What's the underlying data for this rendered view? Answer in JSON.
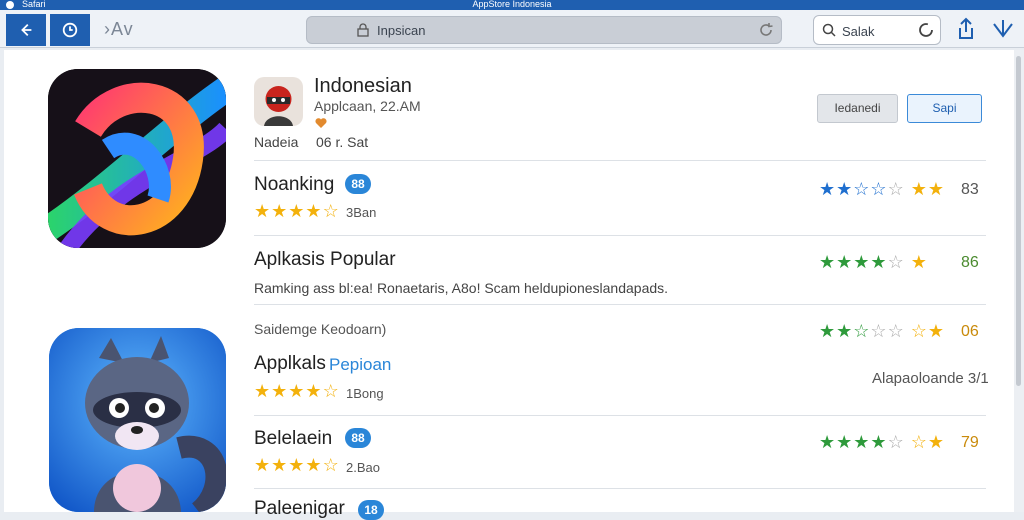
{
  "titlebar": {
    "app_name": "Safari",
    "window_title": "AppStore Indonesia"
  },
  "toolbar": {
    "breadcrumb": "›Av",
    "address": "Inpsican",
    "search_text": "Salak"
  },
  "header": {
    "title": "Indonesian",
    "subtitle": "Applcaan, 22.AM",
    "meta_left": "Nadeia",
    "meta_right": "06 r. Sat",
    "button_secondary": "Iedanedi",
    "button_primary": "Sapi"
  },
  "rows": [
    {
      "title": "Noanking",
      "badge": "88",
      "star_count": "3Ban",
      "rating_num": "83",
      "stars_filled": 2
    },
    {
      "title": "Aplkasis Popular",
      "description": "Ramking ass bl:ea! Ronaetaris, A8o! Scam heldupioneslandapads.",
      "rating_num": "86",
      "stars_filled": 4
    },
    {
      "overline": "Saidemge Keodoarn)",
      "rating_num": "06",
      "stars_filled": 2
    },
    {
      "title_part1": "Applkals",
      "title_part2": "Pepioan",
      "star_count": "1Bong",
      "right_note": "Alapaoloande 3/1"
    },
    {
      "title": "Belelaein",
      "badge": "88",
      "star_count": "2.Bao",
      "rating_num": "79",
      "stars_filled": 4
    },
    {
      "title": "Paleenigar",
      "badge": "18"
    }
  ],
  "colors": {
    "accent": "#1f5fb0",
    "star_gold": "#f3b10c",
    "star_green": "#2e9a3b",
    "star_blue": "#1f6fcf",
    "badge": "#2a86d8"
  }
}
